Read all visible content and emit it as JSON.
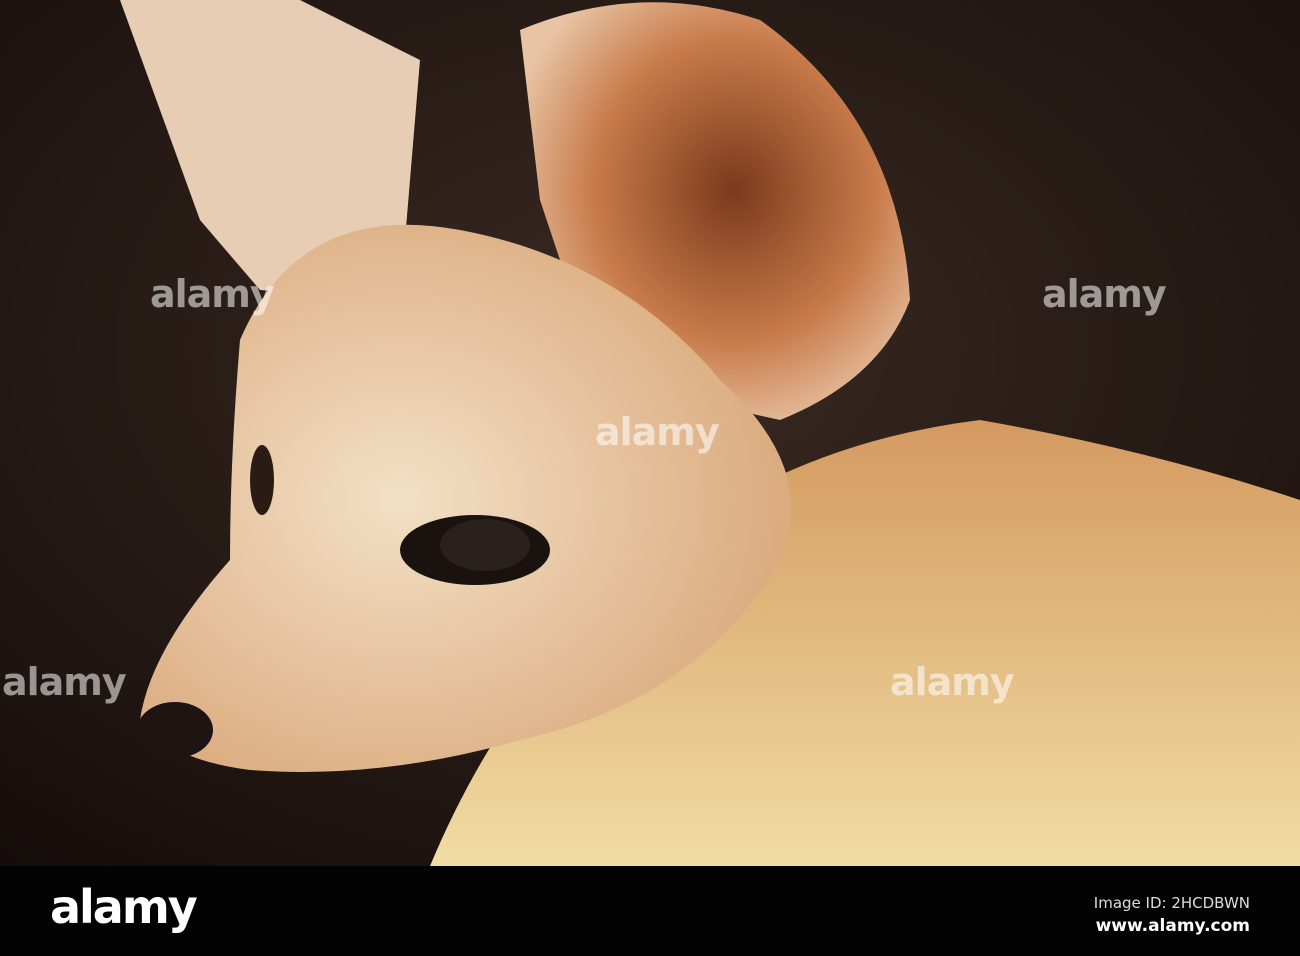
{
  "photo": {
    "subject": "fennec fox close-up"
  },
  "watermark": {
    "text": "alamy"
  },
  "footer": {
    "logo": "alamy",
    "image_id": "Image ID: 2HCDBWN",
    "site": "www.alamy.com"
  }
}
